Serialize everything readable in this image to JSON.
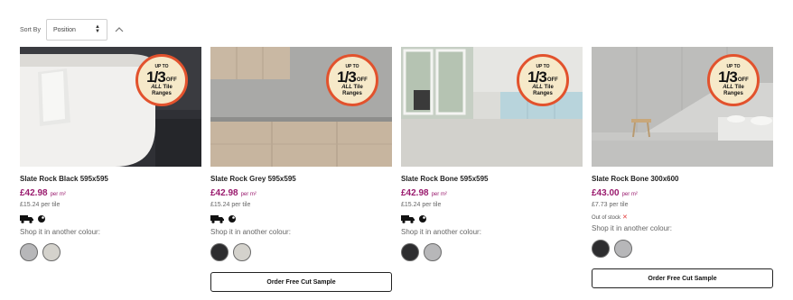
{
  "sort": {
    "label": "Sort By",
    "selected": "Position",
    "direction_icon": "chevron-up-icon"
  },
  "promo": {
    "up_to": "UP TO",
    "fraction": "1/3",
    "off": "OFF",
    "all": "ALL",
    "tile": "Tile",
    "ranges": "Ranges",
    "badge_color": "#e2522d"
  },
  "colors": {
    "price": "#9a1b6e",
    "out_of_stock_x": "#e23838"
  },
  "labels": {
    "shop_another": "Shop it in another colour:",
    "sample_button": "Order Free Cut Sample",
    "out_of_stock": "Out of stock",
    "out_of_stock_mark": "✕"
  },
  "products": [
    {
      "name": "Slate Rock Black 595x595",
      "price": "£42.98",
      "price_unit": "per m²",
      "per_tile": "£15.24 per tile",
      "icons": [
        "delivery-truck-icon",
        "click-collect-icon"
      ],
      "swatches": [
        "#b7b7b9",
        "#d4d2cc"
      ]
    },
    {
      "name": "Slate Rock Grey 595x595",
      "price": "£42.98",
      "price_unit": "per m²",
      "per_tile": "£15.24 per tile",
      "icons": [
        "delivery-truck-icon",
        "click-collect-icon"
      ],
      "swatches": [
        "#2d2d2f",
        "#d4d2cc"
      ]
    },
    {
      "name": "Slate Rock Bone 595x595",
      "price": "£42.98",
      "price_unit": "per m²",
      "per_tile": "£15.24 per tile",
      "icons": [
        "delivery-truck-icon",
        "click-collect-icon"
      ],
      "swatches": [
        "#2d2d2f",
        "#b7b7b9"
      ]
    },
    {
      "name": "Slate Rock Bone 300x600",
      "price": "£43.00",
      "price_unit": "per m²",
      "per_tile": "£7.73 per tile",
      "out_of_stock": true,
      "swatches": [
        "#2d2d2f",
        "#b7b7b9"
      ]
    }
  ]
}
